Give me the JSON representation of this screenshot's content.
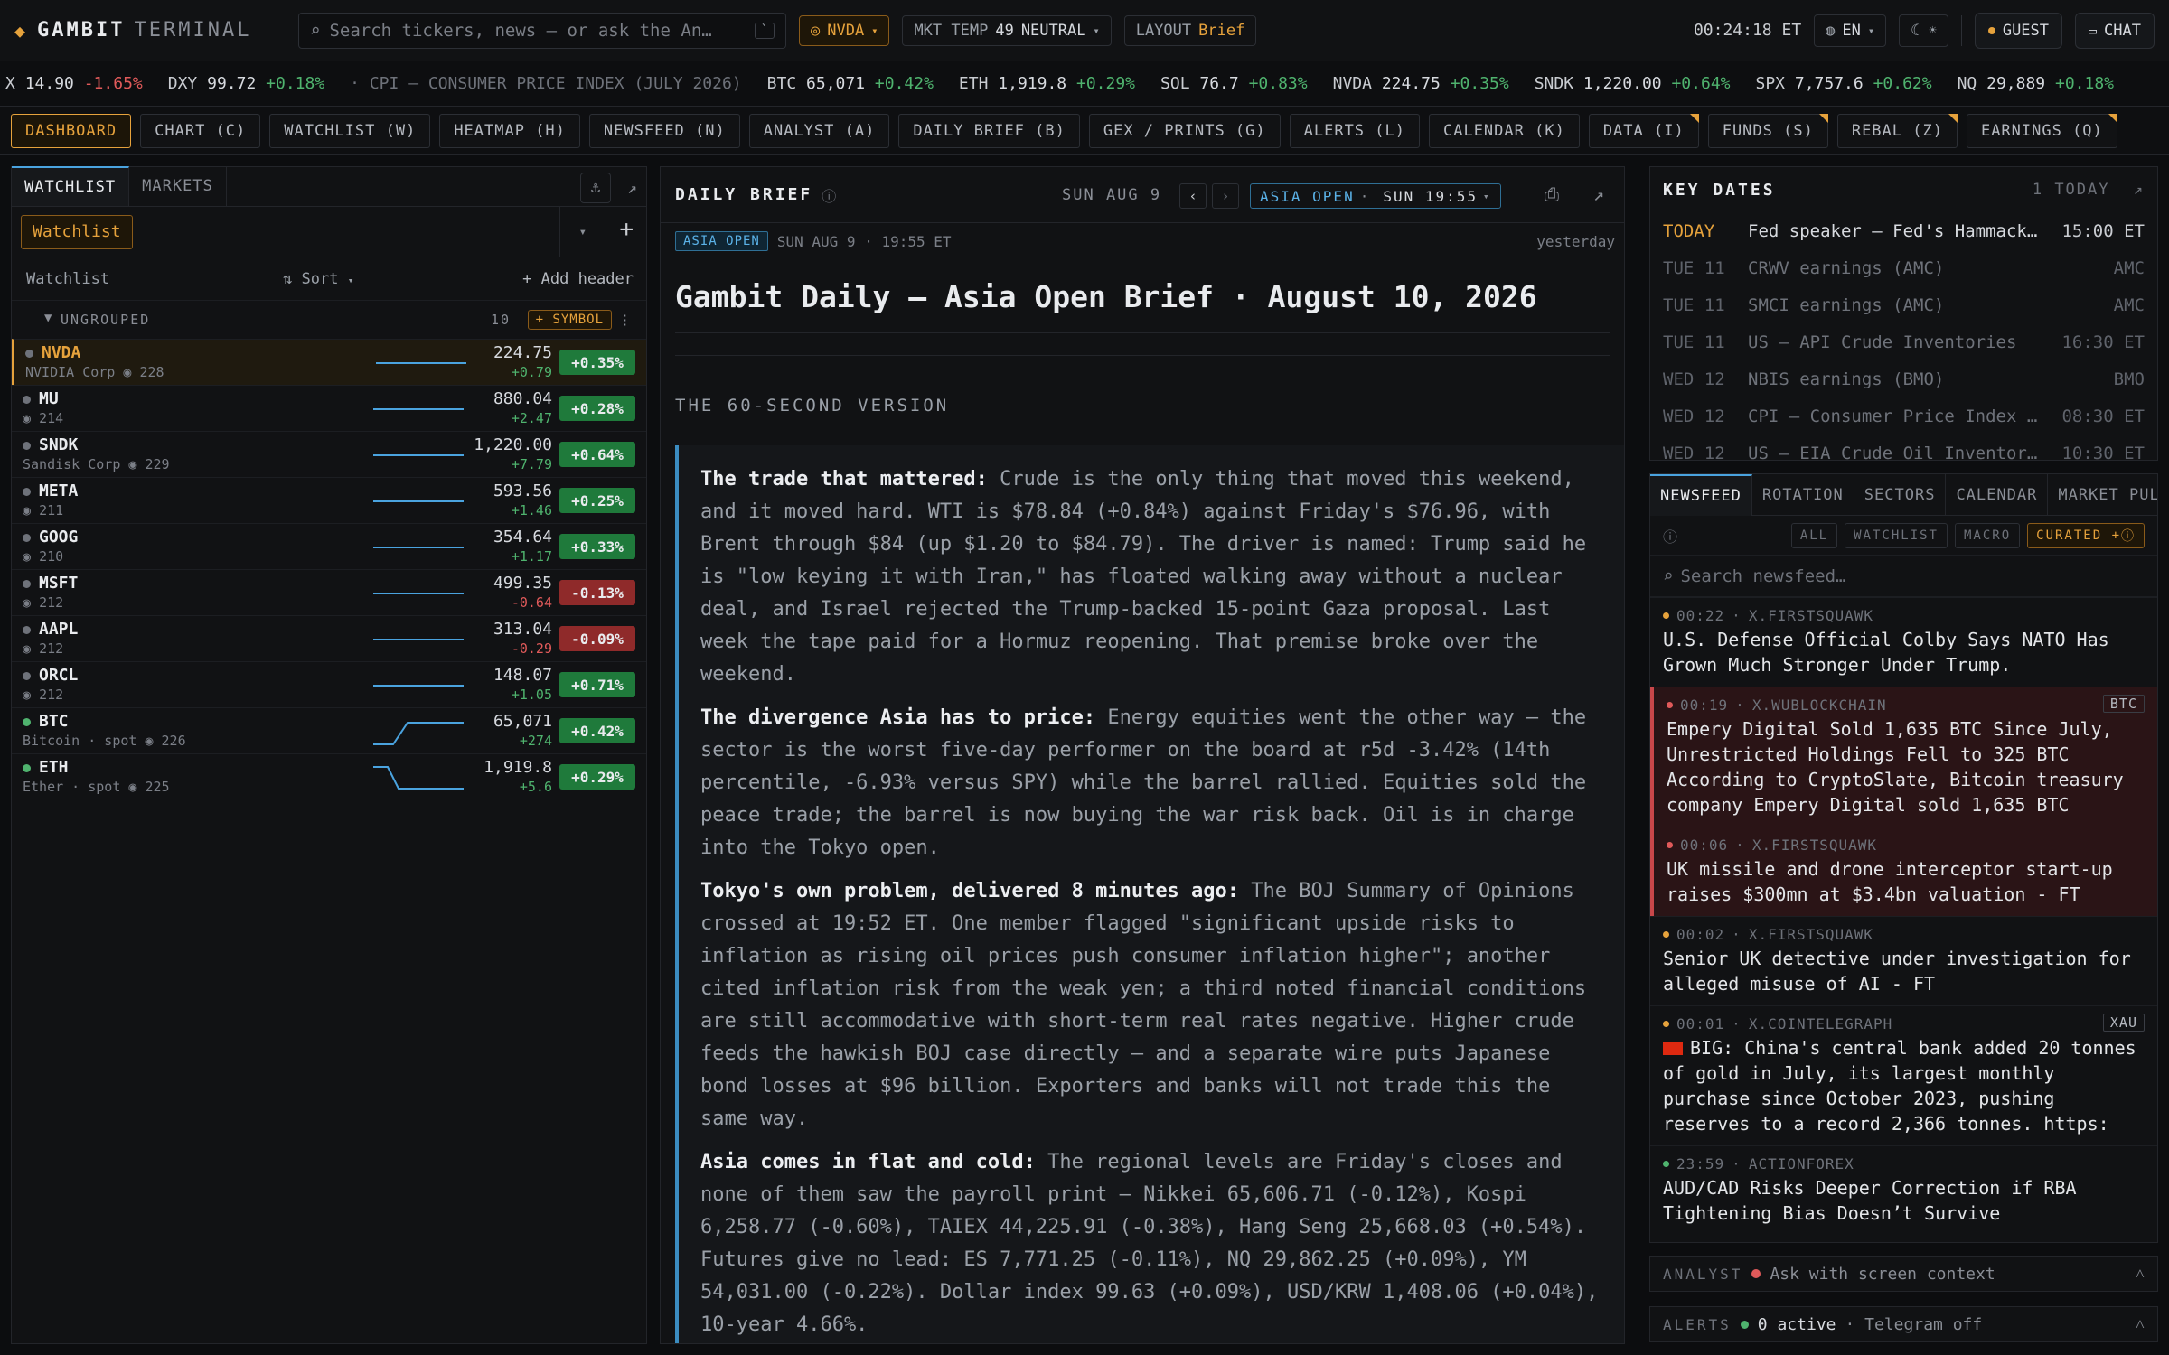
{
  "brand": {
    "name": "GAMBIT",
    "suffix": "TERMINAL"
  },
  "search": {
    "placeholder": "Search tickers, news — or ask the An…",
    "kbd": "`"
  },
  "header": {
    "symbol_pill": "NVDA",
    "mkt_temp_label": "MKT TEMP",
    "mkt_temp_value": "49",
    "mkt_temp_state": "NEUTRAL",
    "layout_label": "LAYOUT",
    "layout_value": "Brief",
    "clock": "00:24:18 ET",
    "lang": "EN",
    "guest": "GUEST",
    "chat": "CHAT"
  },
  "ticker": [
    {
      "sym": "X",
      "val": "14.90",
      "chg": "-1.65%",
      "dir": "dn"
    },
    {
      "sym": "DXY",
      "val": "99.72",
      "chg": "+0.18%",
      "dir": "up"
    },
    {
      "sym": "· CPI — CONSUMER PRICE INDEX (JULY 2026)",
      "val": "",
      "chg": "",
      "dir": "dim"
    },
    {
      "sym": "BTC",
      "val": "65,071",
      "chg": "+0.42%",
      "dir": "up"
    },
    {
      "sym": "ETH",
      "val": "1,919.8",
      "chg": "+0.29%",
      "dir": "up"
    },
    {
      "sym": "SOL",
      "val": "76.7",
      "chg": "+0.83%",
      "dir": "up"
    },
    {
      "sym": "NVDA",
      "val": "224.75",
      "chg": "+0.35%",
      "dir": "up"
    },
    {
      "sym": "SNDK",
      "val": "1,220.00",
      "chg": "+0.64%",
      "dir": "up"
    },
    {
      "sym": "SPX",
      "val": "7,757.6",
      "chg": "+0.62%",
      "dir": "up"
    },
    {
      "sym": "NQ",
      "val": "29,889",
      "chg": "+0.18%",
      "dir": "up"
    }
  ],
  "nav_tabs": [
    {
      "label": "DASHBOARD",
      "active": true,
      "corner": false
    },
    {
      "label": "CHART (C)",
      "active": false,
      "corner": false
    },
    {
      "label": "WATCHLIST (W)",
      "active": false,
      "corner": false
    },
    {
      "label": "HEATMAP (H)",
      "active": false,
      "corner": false
    },
    {
      "label": "NEWSFEED (N)",
      "active": false,
      "corner": false
    },
    {
      "label": "ANALYST (A)",
      "active": false,
      "corner": false
    },
    {
      "label": "DAILY BRIEF (B)",
      "active": false,
      "corner": false
    },
    {
      "label": "GEX / PRINTS (G)",
      "active": false,
      "corner": false
    },
    {
      "label": "ALERTS (L)",
      "active": false,
      "corner": false
    },
    {
      "label": "CALENDAR (K)",
      "active": false,
      "corner": false
    },
    {
      "label": "DATA (I)",
      "active": false,
      "corner": true
    },
    {
      "label": "FUNDS (S)",
      "active": false,
      "corner": true
    },
    {
      "label": "REBAL (Z)",
      "active": false,
      "corner": true
    },
    {
      "label": "EARNINGS (Q)",
      "active": false,
      "corner": true
    }
  ],
  "watchlist": {
    "tabs": [
      "WATCHLIST",
      "MARKETS"
    ],
    "selected": "Watchlist",
    "header_label": "Watchlist",
    "sort_label": "Sort",
    "add_header": "+ Add header",
    "group_label": "UNGROUPED",
    "group_count": "10",
    "symbol_btn": "+ SYMBOL",
    "rows": [
      {
        "sym": "NVDA",
        "name": "NVIDIA Corp",
        "watchers": "228",
        "price": "224.75",
        "chg": "+0.79",
        "pct": "+0.35%",
        "dir": "up",
        "dot": "grey",
        "spark": [
          0.5,
          0.5,
          0.5,
          0.5,
          0.5
        ],
        "selected": true
      },
      {
        "sym": "MU",
        "name": "",
        "watchers": "214",
        "price": "880.04",
        "chg": "+2.47",
        "pct": "+0.28%",
        "dir": "up",
        "dot": "grey",
        "spark": [
          0.5,
          0.5,
          0.5,
          0.5,
          0.5
        ],
        "selected": false
      },
      {
        "sym": "SNDK",
        "name": "Sandisk Corp",
        "watchers": "229",
        "price": "1,220.00",
        "chg": "+7.79",
        "pct": "+0.64%",
        "dir": "up",
        "dot": "grey",
        "spark": [
          0.5,
          0.5,
          0.5,
          0.5,
          0.5
        ],
        "selected": false
      },
      {
        "sym": "META",
        "name": "",
        "watchers": "211",
        "price": "593.56",
        "chg": "+1.46",
        "pct": "+0.25%",
        "dir": "up",
        "dot": "grey",
        "spark": [
          0.5,
          0.5,
          0.5,
          0.5,
          0.5
        ],
        "selected": false
      },
      {
        "sym": "GOOG",
        "name": "",
        "watchers": "210",
        "price": "354.64",
        "chg": "+1.17",
        "pct": "+0.33%",
        "dir": "up",
        "dot": "grey",
        "spark": [
          0.5,
          0.5,
          0.5,
          0.5,
          0.5
        ],
        "selected": false
      },
      {
        "sym": "MSFT",
        "name": "",
        "watchers": "212",
        "price": "499.35",
        "chg": "-0.64",
        "pct": "-0.13%",
        "dir": "dn",
        "dot": "grey",
        "spark": [
          0.5,
          0.5,
          0.5,
          0.5,
          0.5
        ],
        "selected": false
      },
      {
        "sym": "AAPL",
        "name": "",
        "watchers": "212",
        "price": "313.04",
        "chg": "-0.29",
        "pct": "-0.09%",
        "dir": "dn",
        "dot": "grey",
        "spark": [
          0.5,
          0.5,
          0.5,
          0.5,
          0.5
        ],
        "selected": false
      },
      {
        "sym": "ORCL",
        "name": "",
        "watchers": "212",
        "price": "148.07",
        "chg": "+1.05",
        "pct": "+0.71%",
        "dir": "up",
        "dot": "grey",
        "spark": [
          0.5,
          0.5,
          0.5,
          0.5,
          0.5
        ],
        "selected": false
      },
      {
        "sym": "BTC",
        "name": "Bitcoin · spot",
        "watchers": "226",
        "price": "65,071",
        "chg": "+274",
        "pct": "+0.42%",
        "dir": "up",
        "dot": "green",
        "spark": [
          0.1,
          0.1,
          0.9,
          0.9,
          0.9
        ],
        "selected": false
      },
      {
        "sym": "ETH",
        "name": "Ether · spot",
        "watchers": "225",
        "price": "1,919.8",
        "chg": "+5.6",
        "pct": "+0.29%",
        "dir": "up",
        "dot": "green",
        "spark": [
          0.9,
          0.9,
          0.1,
          0.1,
          0.1
        ],
        "selected": false
      }
    ]
  },
  "brief": {
    "header": "DAILY BRIEF",
    "date": "SUN AUG 9",
    "session_label": "ASIA OPEN",
    "session_time": "SUN 19:55",
    "tag": "ASIA OPEN",
    "meta": "SUN AUG 9 · 19:55 ET",
    "ago": "yesterday",
    "title": "Gambit Daily — Asia Open Brief · August 10, 2026",
    "section": "THE 60-SECOND VERSION",
    "paragraphs": [
      {
        "lead": "The trade that mattered:",
        "text": " Crude is the only thing that moved this weekend, and it moved hard. WTI is $78.84 (+0.84%) against Friday's $76.96, with Brent through $84 (up $1.20 to $84.79). The driver is named: Trump said he is \"low keying it with Iran,\" has floated walking away without a nuclear deal, and Israel rejected the Trump-backed 15-point Gaza proposal. Last week the tape paid for a Hormuz reopening. That premise broke over the weekend."
      },
      {
        "lead": "The divergence Asia has to price:",
        "text": " Energy equities went the other way — the sector is the worst five-day performer on the board at r5d -3.42% (14th percentile, -6.93% versus SPY) while the barrel rallied. Equities sold the peace trade; the barrel is now buying the war risk back. Oil is in charge into the Tokyo open."
      },
      {
        "lead": "Tokyo's own problem, delivered 8 minutes ago:",
        "text": " The BOJ Summary of Opinions crossed at 19:52 ET. One member flagged \"significant upside risks to inflation as rising oil prices push consumer inflation higher\"; another cited inflation risk from the weak yen; a third noted financial conditions are still accommodative with short-term real rates negative. Higher crude feeds the hawkish BOJ case directly — and a separate wire puts Japanese bond losses at $96 billion. Exporters and banks will not trade this the same way."
      },
      {
        "lead": "Asia comes in flat and cold:",
        "text": " The regional levels are Friday's closes and none of them saw the payroll print — Nikkei 65,606.71 (-0.12%), Kospi 6,258.77 (-0.60%), TAIEX 44,225.91 (-0.38%), Hang Seng 25,668.03 (+0.54%). Futures give no lead: ES 7,771.25 (-0.11%), NQ 29,862.25 (+0.09%), YM 54,031.00 (-0.22%). Dollar index 99.63 (+0.09%), USD/KRW 1,408.06 (+0.04%), 10-year 4.66%."
      }
    ]
  },
  "key_dates": {
    "title": "KEY DATES",
    "today_count": "1 TODAY",
    "items": [
      {
        "day": "TODAY",
        "event": "Fed speaker — Fed's Hammack…",
        "time": "15:00 ET",
        "today": true
      },
      {
        "day": "TUE 11",
        "event": "CRWV earnings (AMC)",
        "time": "AMC",
        "today": false
      },
      {
        "day": "TUE 11",
        "event": "SMCI earnings (AMC)",
        "time": "AMC",
        "today": false
      },
      {
        "day": "TUE 11",
        "event": "US — API Crude Inventories",
        "time": "16:30 ET",
        "today": false
      },
      {
        "day": "WED 12",
        "event": "NBIS earnings (BMO)",
        "time": "BMO",
        "today": false
      },
      {
        "day": "WED 12",
        "event": "CPI — Consumer Price Index …",
        "time": "08:30 ET",
        "today": false
      },
      {
        "day": "WED 12",
        "event": "US — EIA Crude Oil Inventor…",
        "time": "10:30 ET",
        "today": false
      }
    ]
  },
  "newsfeed": {
    "tabs": [
      "NEWSFEED",
      "ROTATION",
      "SECTORS",
      "CALENDAR",
      "MARKET PUL"
    ],
    "filters": [
      "ALL",
      "WATCHLIST",
      "MACRO",
      "CURATED +"
    ],
    "search_placeholder": "Search newsfeed…",
    "items": [
      {
        "time": "00:22",
        "source": "X.FIRSTSQUAWK",
        "headline": "U.S. Defense Official Colby Says NATO Has Grown Much Stronger Under Trump.",
        "badge": "",
        "red": false,
        "dot": "amber",
        "flag": false
      },
      {
        "time": "00:19",
        "source": "X.WUBLOCKCHAIN",
        "headline": "Empery Digital Sold 1,635 BTC Since July, Unrestricted Holdings Fell to 325 BTC According to CryptoSlate, Bitcoin treasury company Empery Digital sold 1,635 BTC",
        "badge": "BTC",
        "red": true,
        "dot": "red",
        "flag": false
      },
      {
        "time": "00:06",
        "source": "X.FIRSTSQUAWK",
        "headline": "UK missile and drone interceptor start-up raises $300mn at $3.4bn valuation - FT",
        "badge": "",
        "red": true,
        "dot": "red",
        "flag": false
      },
      {
        "time": "00:02",
        "source": "X.FIRSTSQUAWK",
        "headline": "Senior UK detective under investigation for alleged misuse of AI - FT",
        "badge": "",
        "red": false,
        "dot": "amber",
        "flag": false
      },
      {
        "time": "00:01",
        "source": "X.COINTELEGRAPH",
        "headline": "BIG: China's central bank added 20 tonnes of gold in July, its largest monthly purchase since October 2023, pushing reserves to a record 2,366 tonnes. https:",
        "badge": "XAU",
        "red": false,
        "dot": "amber",
        "flag": true
      },
      {
        "time": "23:59",
        "source": "ACTIONFOREX",
        "headline": "AUD/CAD Risks Deeper Correction if RBA Tightening Bias Doesn’t Survive",
        "badge": "",
        "red": false,
        "dot": "green",
        "flag": false
      }
    ]
  },
  "analyst_bar": {
    "label": "ANALYST",
    "text": "Ask with screen context"
  },
  "alerts_bar": {
    "label": "ALERTS",
    "count": "0 active",
    "telegram": "· Telegram off"
  }
}
